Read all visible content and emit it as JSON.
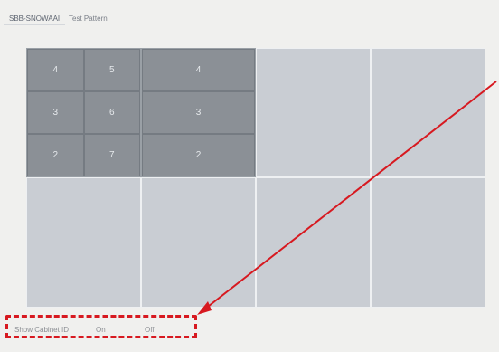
{
  "tabs": [
    {
      "label": "SBB-SNOWAAI",
      "active": true
    },
    {
      "label": "Test Pattern",
      "active": false
    }
  ],
  "wall": {
    "cabinets": [
      {
        "id": "cab-1",
        "active": true,
        "cells": [
          "4",
          "5",
          "3",
          "6",
          "2",
          "7"
        ]
      },
      {
        "id": "cab-2",
        "active": true,
        "cells": [
          "4",
          "3",
          "2"
        ]
      },
      {
        "id": "cab-3",
        "active": false,
        "cells": []
      },
      {
        "id": "cab-4",
        "active": false,
        "cells": []
      },
      {
        "id": "cab-5",
        "active": false,
        "cells": []
      },
      {
        "id": "cab-6",
        "active": false,
        "cells": []
      },
      {
        "id": "cab-7",
        "active": false,
        "cells": []
      },
      {
        "id": "cab-8",
        "active": false,
        "cells": []
      }
    ]
  },
  "controls": {
    "show_cabinet_id_label": "Show Cabinet ID",
    "on_label": "On",
    "off_label": "Off"
  },
  "annotation": {
    "color": "#d71920",
    "kind": "dashed-box-with-arrow"
  }
}
